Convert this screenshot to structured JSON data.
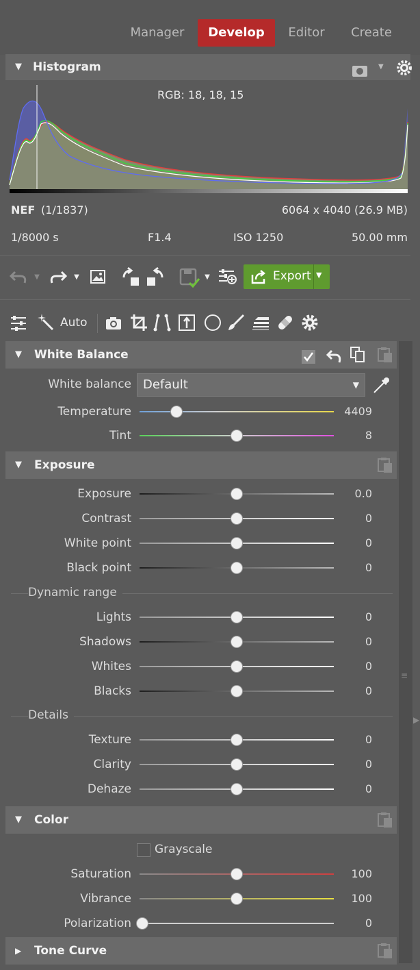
{
  "tabs": [
    "Manager",
    "Develop",
    "Editor",
    "Create"
  ],
  "histogram": {
    "title": "Histogram",
    "rgb_readout": "RGB:  18,  18,  15"
  },
  "file_info": {
    "format": "NEF",
    "index": "(1/1837)",
    "dimensions": "6064 x 4040 (26.9 MB)",
    "shutter": "1/8000 s",
    "aperture": "F1.4",
    "iso": "ISO 1250",
    "focal_length": "50.00 mm"
  },
  "toolbar": {
    "export_label": "Export"
  },
  "tools_row": {
    "auto_label": "Auto"
  },
  "white_balance": {
    "title": "White Balance",
    "wb_label": "White balance",
    "wb_value": "Default",
    "temperature_label": "Temperature",
    "temperature_value": "4409",
    "temperature_fraction": 0.19,
    "tint_label": "Tint",
    "tint_value": "8",
    "tint_fraction": 0.5
  },
  "exposure": {
    "title": "Exposure",
    "sliders": [
      {
        "label": "Exposure",
        "value": "0.0"
      },
      {
        "label": "Contrast",
        "value": "0"
      },
      {
        "label": "White point",
        "value": "0"
      },
      {
        "label": "Black point",
        "value": "0"
      }
    ],
    "dynamic_range_label": "Dynamic range",
    "dynamic_range": [
      {
        "label": "Lights",
        "value": "0"
      },
      {
        "label": "Shadows",
        "value": "0"
      },
      {
        "label": "Whites",
        "value": "0"
      },
      {
        "label": "Blacks",
        "value": "0"
      }
    ],
    "details_label": "Details",
    "details": [
      {
        "label": "Texture",
        "value": "0"
      },
      {
        "label": "Clarity",
        "value": "0"
      },
      {
        "label": "Dehaze",
        "value": "0"
      }
    ]
  },
  "color": {
    "title": "Color",
    "grayscale_label": "Grayscale",
    "grayscale_checked": false,
    "saturation_label": "Saturation",
    "saturation_value": "100",
    "vibrance_label": "Vibrance",
    "vibrance_value": "100",
    "polarization_label": "Polarization",
    "polarization_value": "0",
    "polarization_fraction": 0.0
  },
  "tone_curve": {
    "title": "Tone Curve"
  },
  "colors": {
    "accent_develop": "#b52a2a",
    "export_green": "#5f9b2f"
  }
}
